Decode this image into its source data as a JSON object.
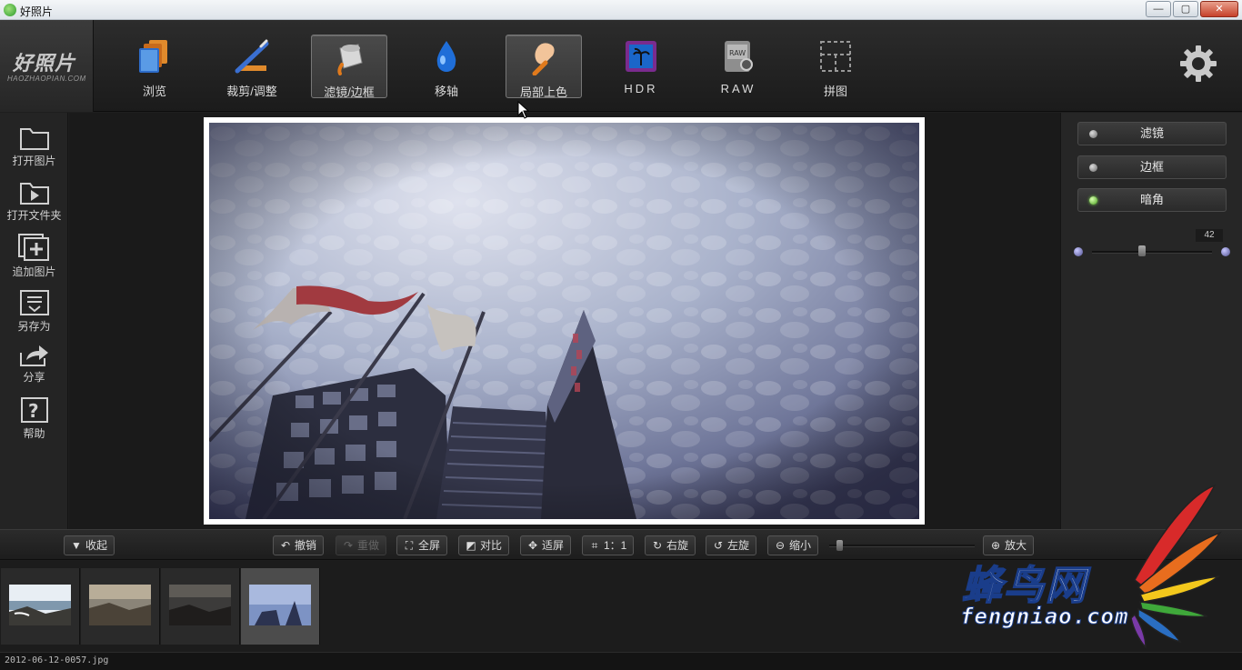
{
  "window": {
    "title": "好照片",
    "minimize": "—",
    "maximize": "▢",
    "close": "✕"
  },
  "logo": {
    "name": "好照片",
    "domain": "HAOZHAOPIAN.COM"
  },
  "toolbar": {
    "tools": [
      {
        "label": "浏览",
        "icon": "browse-icon",
        "active": false
      },
      {
        "label": "裁剪/调整",
        "icon": "crop-adjust-icon",
        "active": false
      },
      {
        "label": "滤镜/边框",
        "icon": "filter-frame-icon",
        "active": true
      },
      {
        "label": "移轴",
        "icon": "tilt-shift-icon",
        "active": false
      },
      {
        "label": "局部上色",
        "icon": "partial-color-icon",
        "active": true
      },
      {
        "label": "HDR",
        "icon": "hdr-icon",
        "active": false
      },
      {
        "label": "RAW",
        "icon": "raw-icon",
        "active": false
      },
      {
        "label": "拼图",
        "icon": "collage-icon",
        "active": false
      }
    ],
    "settings_icon": "gear-icon"
  },
  "sidebar": {
    "items": [
      {
        "label": "打开图片",
        "icon": "folder-icon"
      },
      {
        "label": "打开文件夹",
        "icon": "play-folder-icon"
      },
      {
        "label": "追加图片",
        "icon": "add-image-icon"
      },
      {
        "label": "另存为",
        "icon": "save-as-icon"
      },
      {
        "label": "分享",
        "icon": "share-icon"
      },
      {
        "label": "帮助",
        "icon": "help-icon"
      }
    ]
  },
  "right_panel": {
    "buttons": [
      {
        "label": "滤镜",
        "active": false
      },
      {
        "label": "边框",
        "active": false
      },
      {
        "label": "暗角",
        "active": true
      }
    ],
    "slider": {
      "value": "42",
      "level": 0.42
    }
  },
  "bottom_toolbar": {
    "collapse": "收起",
    "undo": "撤销",
    "redo": "重做",
    "fullscreen": "全屏",
    "compare": "对比",
    "fit": "适屏",
    "actual_size": "1：1",
    "rotate_right": "右旋",
    "rotate_left": "左旋",
    "zoom_out": "缩小",
    "zoom_in": "放大",
    "zoom_level": 0.05
  },
  "filmstrip": {
    "thumbnails": [
      {
        "selected": false,
        "scene": "seaside-rocks-bright"
      },
      {
        "selected": false,
        "scene": "seaside-rocks-sunset"
      },
      {
        "selected": false,
        "scene": "seaside-rocks-dark"
      },
      {
        "selected": true,
        "scene": "clouds-buildings-blue"
      }
    ]
  },
  "status": {
    "filename": "2012-06-12-0057.jpg"
  },
  "watermark": {
    "zh": "蜂鸟网",
    "en": "fengniao.com"
  },
  "colors": {
    "accent_led": "#4aa21e",
    "watermark_outline": "#1a3d8a"
  }
}
